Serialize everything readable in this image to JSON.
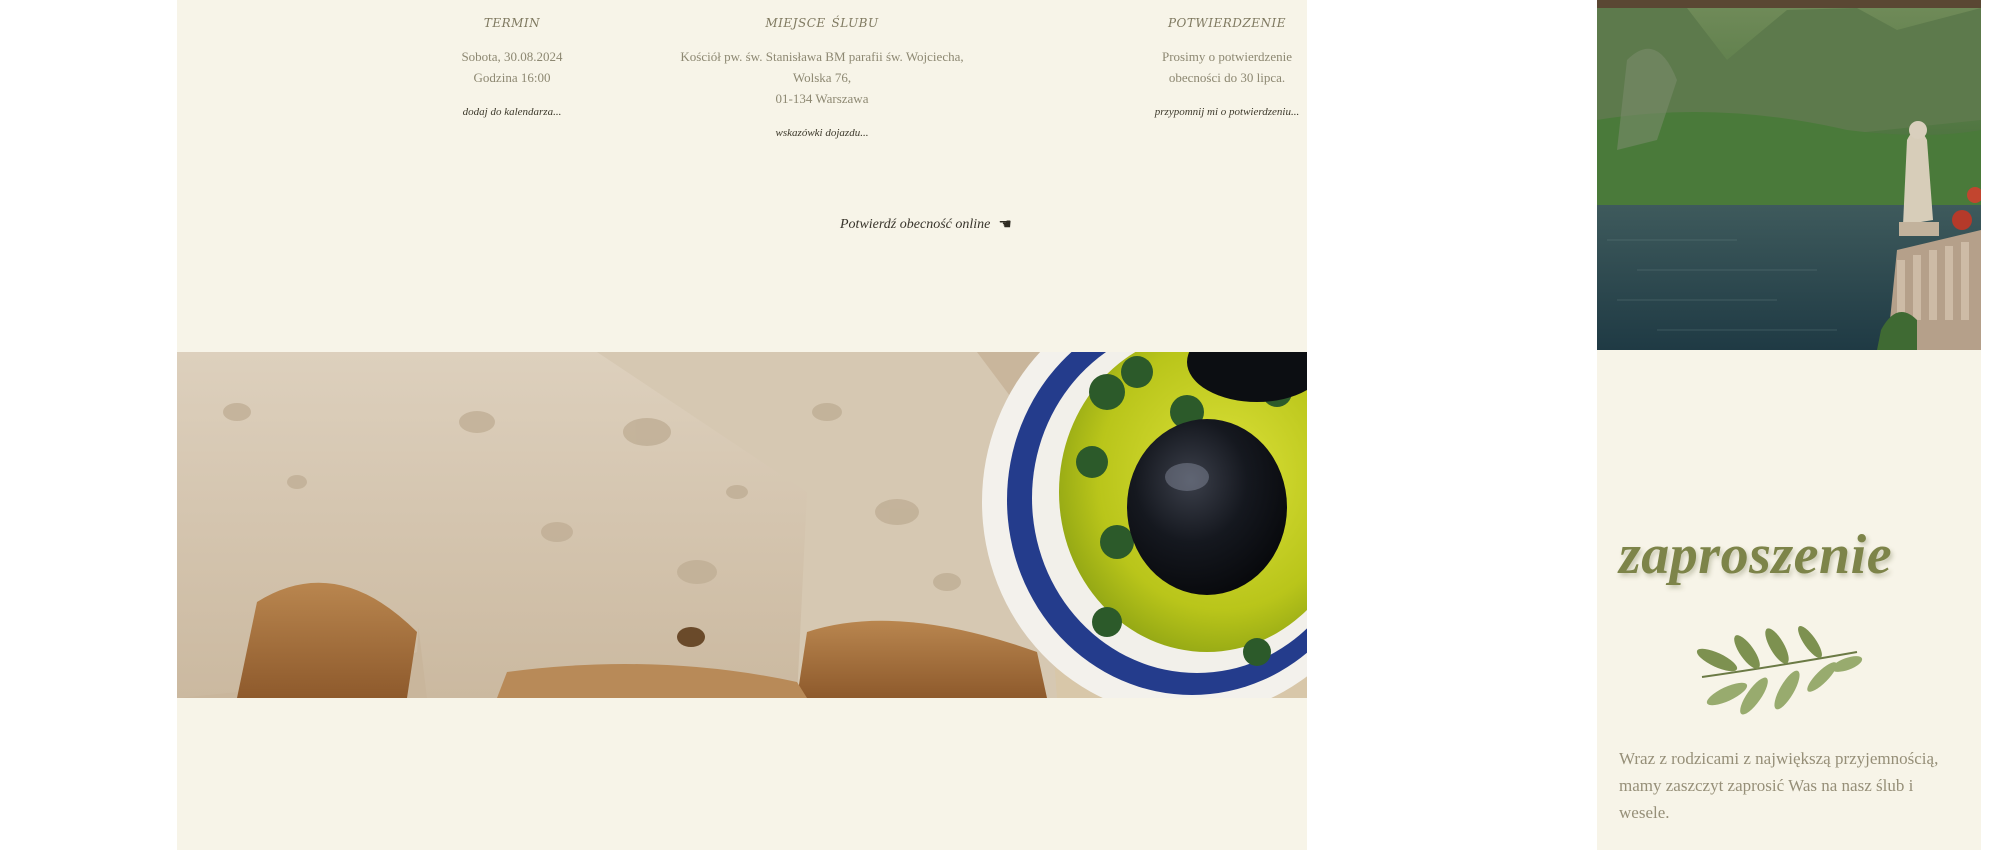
{
  "details": {
    "termin": {
      "heading": "termin",
      "line1": "Sobota, 30.08.2024",
      "line2": "Godzina 16:00",
      "link": "dodaj do kalendarza..."
    },
    "miejsce": {
      "heading": "miejsce ślubu",
      "line1": "Kościół pw. św. Stanisława BM parafii św. Wojciecha,",
      "line2": "Wolska 76,",
      "line3": "01-134 Warszawa",
      "link": "wskazówki dojazdu..."
    },
    "potwierdzenie": {
      "heading": "potwierdzenie",
      "line1": "Prosimy o potwierdzenie",
      "line2": "obecności do 30 lipca.",
      "link": "przypomnij mi o potwierdzeniu..."
    }
  },
  "confirm_online": {
    "label": "Potwierdź obecność online",
    "icon": "pointing-hand-icon",
    "icon_glyph": "☚"
  },
  "invitation": {
    "title": "zaproszenie",
    "text": "Wraz z rodzicami z największą przyjemnością, mamy zaszczyt zaprosić Was na nasz ślub i wesele."
  },
  "colors": {
    "panel_background": "#f7f4e8",
    "title_olive": "#7d8449",
    "body_text": "#8d8872",
    "link_text": "#3e3a2c"
  }
}
